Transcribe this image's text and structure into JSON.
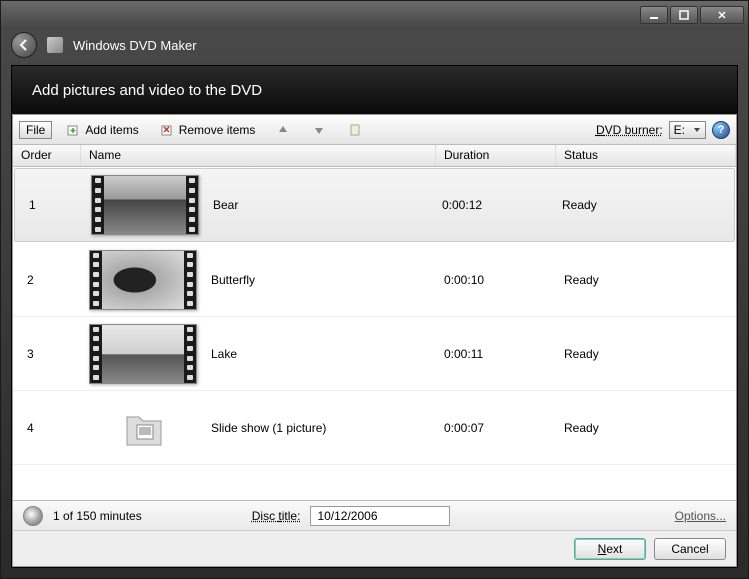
{
  "window": {
    "app_title": "Windows DVD Maker"
  },
  "header": {
    "title": "Add pictures and video to the DVD"
  },
  "toolbar": {
    "file": "File",
    "add_items": "Add items",
    "remove_items": "Remove items",
    "burner_label": "DVD burner:",
    "burner_value": "E:"
  },
  "columns": {
    "order": "Order",
    "name": "Name",
    "duration": "Duration",
    "status": "Status"
  },
  "items": [
    {
      "order": "1",
      "name": "Bear",
      "duration": "0:00:12",
      "status": "Ready",
      "kind": "video",
      "img": "bear",
      "selected": true
    },
    {
      "order": "2",
      "name": "Butterfly",
      "duration": "0:00:10",
      "status": "Ready",
      "kind": "video",
      "img": "butterfly",
      "selected": false
    },
    {
      "order": "3",
      "name": "Lake",
      "duration": "0:00:11",
      "status": "Ready",
      "kind": "video",
      "img": "lake",
      "selected": false
    },
    {
      "order": "4",
      "name": "Slide show (1 picture)",
      "duration": "0:00:07",
      "status": "Ready",
      "kind": "slideshow",
      "img": "folder",
      "selected": false
    }
  ],
  "status": {
    "usage": "1 of 150 minutes",
    "disc_title_label": "Disc title:",
    "disc_title_value": "10/12/2006",
    "options": "Options..."
  },
  "footer": {
    "next": "Next",
    "cancel": "Cancel"
  }
}
